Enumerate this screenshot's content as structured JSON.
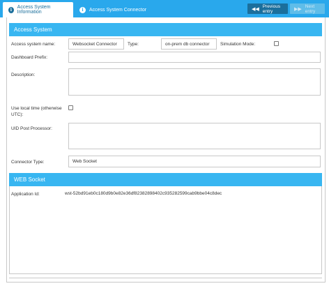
{
  "tabs": [
    {
      "label": "Access System Information"
    },
    {
      "label": "Access System Connector"
    }
  ],
  "nav": {
    "previous_label": "Previous entry",
    "next_label": "Next entry"
  },
  "access_system": {
    "header": "Access System",
    "name_label": "Access system name:",
    "name_value": "Websocket Connector",
    "type_label": "Type:",
    "type_value": "on-prem db connector",
    "simulation_label": "Simulation Mode:",
    "simulation_checked": false,
    "dashboard_prefix_label": "Dashboard Prefix:",
    "dashboard_prefix_value": "",
    "description_label": "Description:",
    "description_value": "",
    "local_time_label": "Use local time (otherwise UTC):",
    "local_time_checked": false,
    "uid_post_processor_label": "UID Post Processor:",
    "uid_post_processor_value": "",
    "connector_type_label": "Connector Type:",
    "connector_type_value": "Web Socket"
  },
  "web_socket": {
    "header": "WEB Socket",
    "application_id_label": "Application Id:",
    "application_id_value": "wst-52bd91eb0c180d9b0e82e36df82382898402c935282599cab9bbe04c8dec"
  },
  "colors": {
    "topbar": "#29a8ec",
    "section_header": "#38b6f1",
    "prev_button": "#1b6f9c",
    "next_button": "#5fbde9"
  }
}
